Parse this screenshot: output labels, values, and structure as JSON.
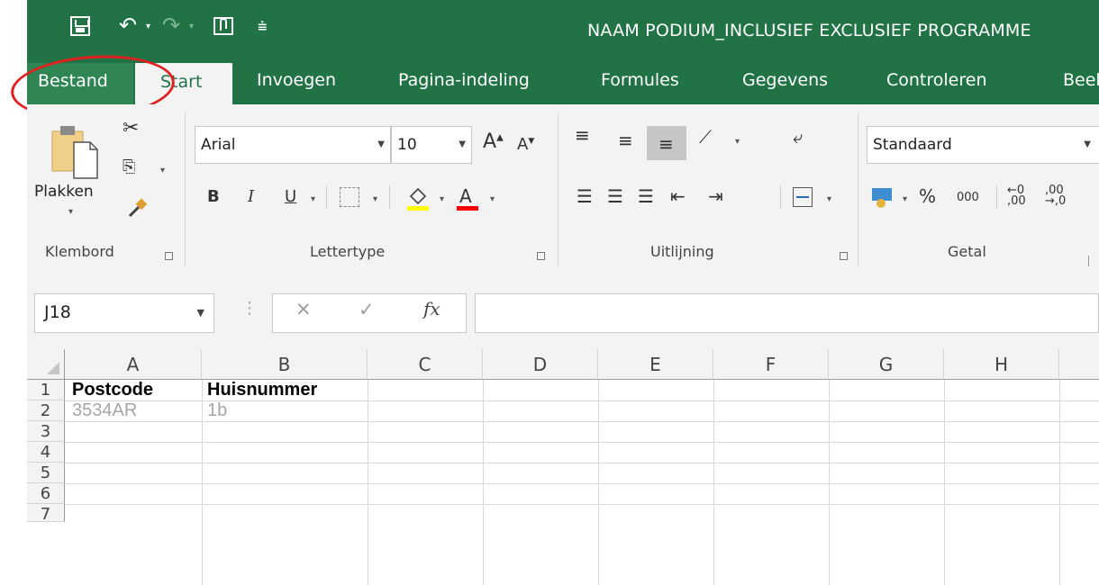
{
  "window": {
    "title": "NAAM PODIUM_INCLUSIEF EXCLUSIEF PROGRAMME"
  },
  "tabs": [
    {
      "label": "Bestand"
    },
    {
      "label": "Start"
    },
    {
      "label": "Invoegen"
    },
    {
      "label": "Pagina-indeling"
    },
    {
      "label": "Formules"
    },
    {
      "label": "Gegevens"
    },
    {
      "label": "Controleren"
    },
    {
      "label": "Beel"
    }
  ],
  "ribbon": {
    "clipboard": {
      "label": "Klembord",
      "paste_label": "Plakken"
    },
    "font": {
      "label": "Lettertype",
      "name": "Arial",
      "size": "10",
      "bold": "B",
      "italic": "I",
      "underline": "U"
    },
    "alignment": {
      "label": "Uitlijning"
    },
    "number": {
      "label": "Getal",
      "format": "Standaard",
      "percent": "%",
      "thousands": "000"
    }
  },
  "formula_bar": {
    "name_box": "J18",
    "fx": "fx",
    "cancel": "✕",
    "confirm": "✓",
    "content": ""
  },
  "sheet": {
    "columns": [
      "A",
      "B",
      "C",
      "D",
      "E",
      "F",
      "G",
      "H"
    ],
    "rows": [
      "1",
      "2",
      "3",
      "4",
      "5",
      "6",
      "7"
    ],
    "cells": {
      "A1": "Postcode",
      "B1": "Huisnummer",
      "A2": "3534AR",
      "B2": "1b"
    }
  },
  "colors": {
    "accent": "#217346",
    "annotation": "#e02020"
  }
}
